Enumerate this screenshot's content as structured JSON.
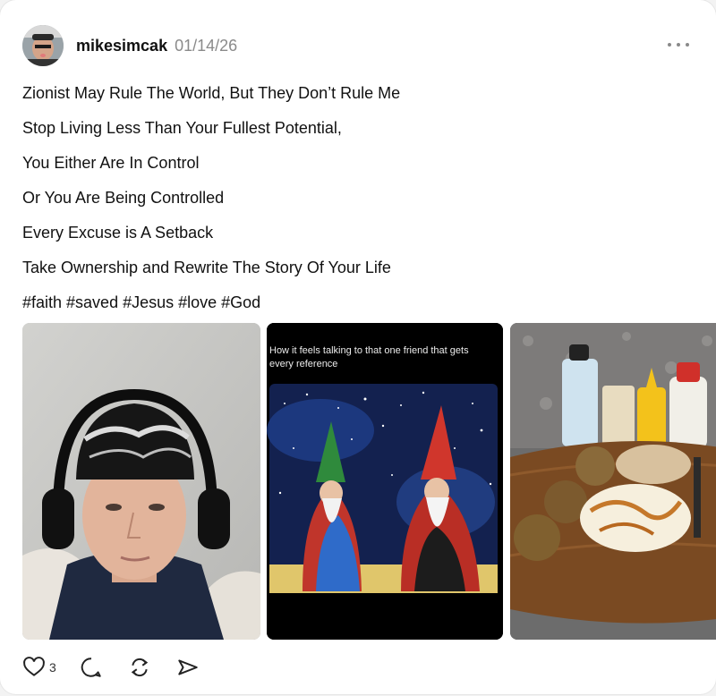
{
  "post": {
    "username": "mikesimcak",
    "date": "01/14/26",
    "lines": [
      "Zionist May Rule The World, But They Don’t Rule Me",
      "Stop Living Less Than Your Fullest Potential,",
      "You Either Are In Control",
      "Or You Are Being Controlled",
      "Every Excuse is A Setback",
      "Take Ownership and Rewrite The Story Of Your Life",
      "#faith #saved #Jesus #love #God"
    ],
    "media": [
      {
        "name": "selfie-photo"
      },
      {
        "name": "wizards-meme",
        "caption": "How it feels talking to that one friend that gets every reference"
      },
      {
        "name": "food-photo"
      }
    ]
  },
  "actions": {
    "like_count": "3",
    "icons": [
      "heart-icon",
      "comment-icon",
      "repost-icon",
      "share-icon"
    ]
  }
}
